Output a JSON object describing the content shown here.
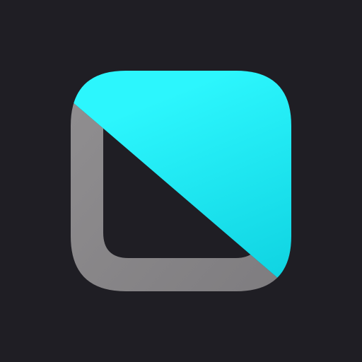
{
  "app_icon": {
    "icon": "app-logo-icon",
    "colors": {
      "background": "#1f1e24",
      "frame_gray": "#8f8d8f",
      "frame_gray_shadow": "#7f7d80",
      "accent_cyan": "#2cf6fd",
      "accent_cyan_shadow": "#10d4e2"
    }
  }
}
